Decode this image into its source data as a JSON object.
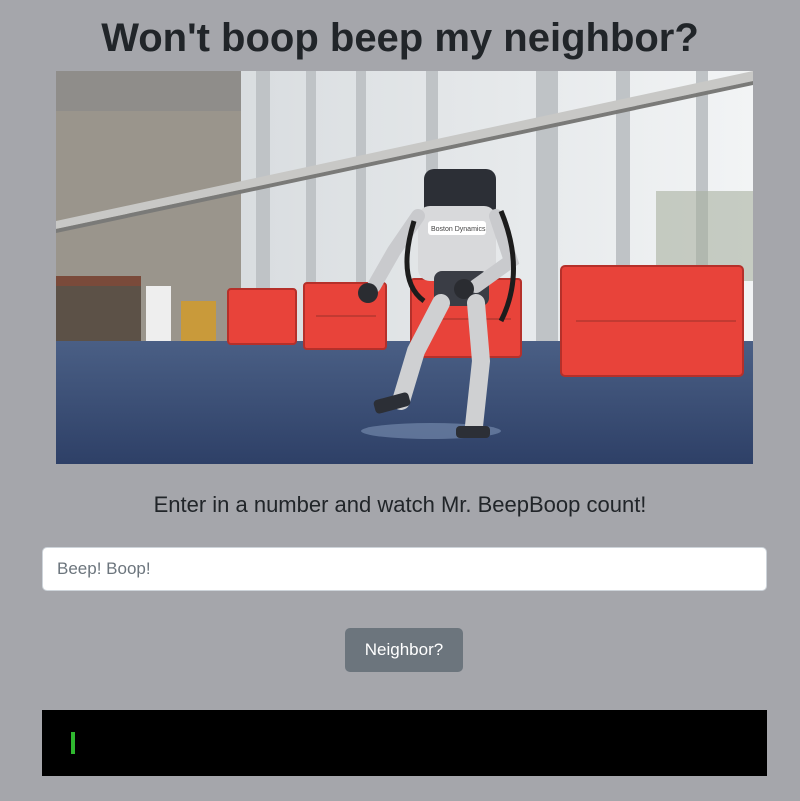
{
  "page": {
    "title": "Won't boop beep my neighbor?",
    "instructions": "Enter in a number and watch Mr. BeepBoop count!"
  },
  "input": {
    "placeholder": "Beep! Boop!",
    "value": ""
  },
  "button": {
    "label": "Neighbor?"
  },
  "terminal": {
    "output": ""
  },
  "colors": {
    "background": "#a5a6ab",
    "button": "#6c757d",
    "terminal": "#000000",
    "cursor": "#2fb82f",
    "barriers": "#e8433a"
  },
  "image": {
    "alt": "A humanoid robot dancing in a warehouse with red barriers",
    "logo_text": "Boston Dynamics"
  }
}
